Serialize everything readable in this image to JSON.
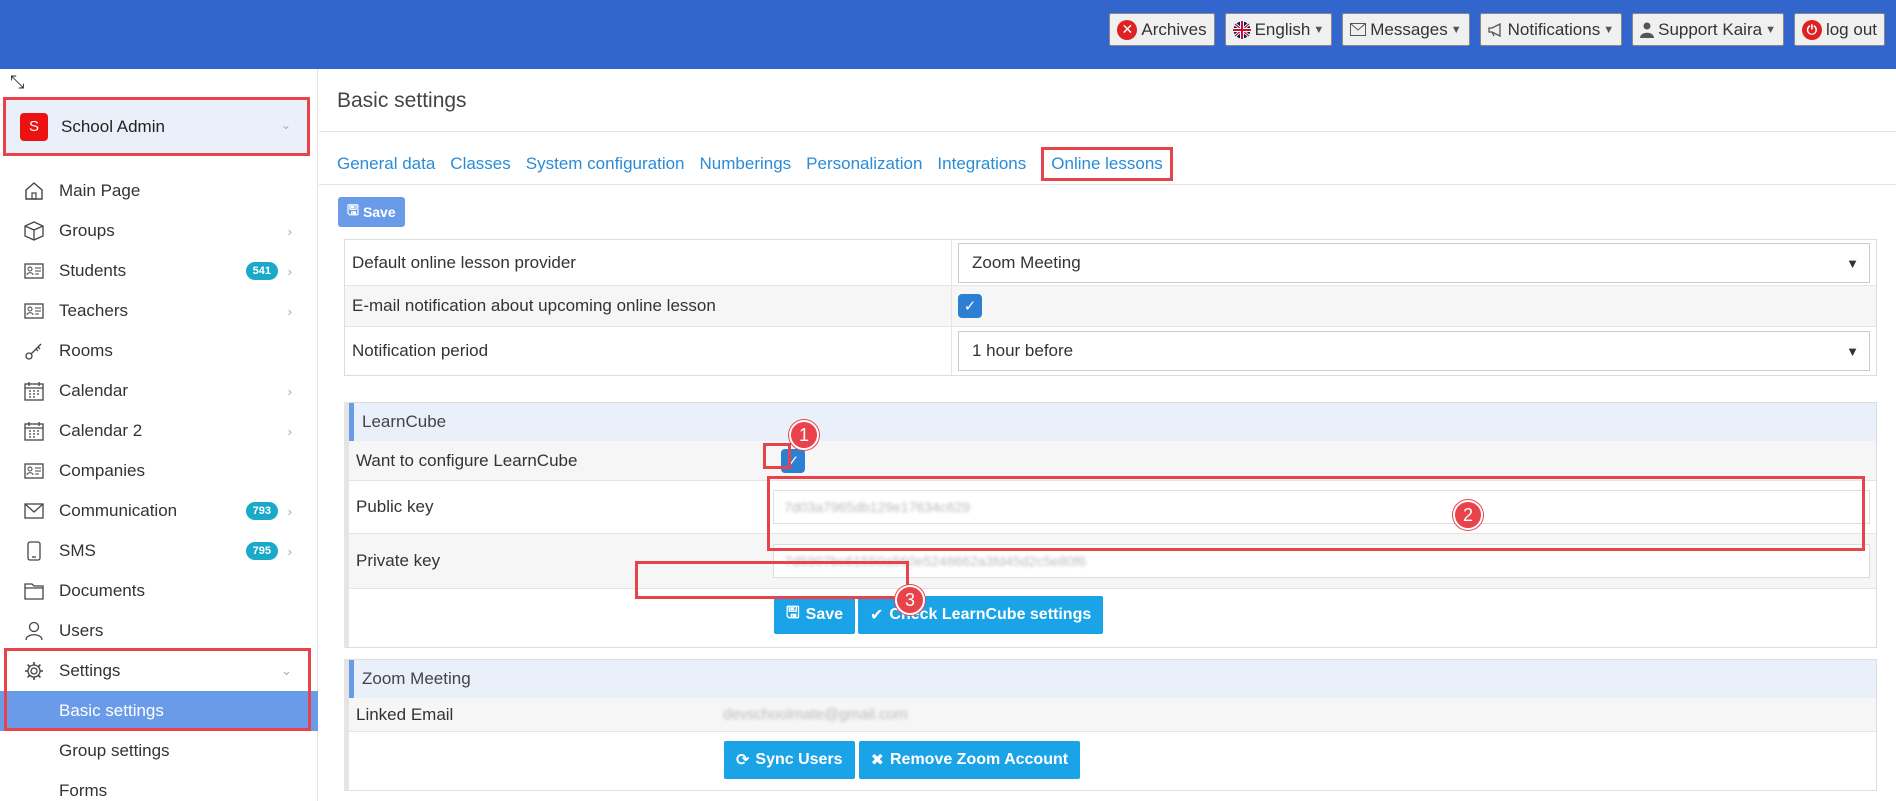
{
  "topbar": {
    "buttons": [
      {
        "label": "Archives",
        "icon": "close-circle-icon"
      },
      {
        "label": "English",
        "icon": "uk-flag-icon"
      },
      {
        "label": "Messages",
        "icon": "envelope-icon"
      },
      {
        "label": "Notifications",
        "icon": "megaphone-icon"
      },
      {
        "label": "Support Kaira",
        "icon": "user-icon"
      },
      {
        "label": "log out",
        "icon": "power-icon"
      }
    ]
  },
  "sidebar": {
    "account": {
      "avatar_letter": "S",
      "label": "School Admin"
    },
    "items": [
      {
        "label": "Main Page",
        "icon": "home-icon"
      },
      {
        "label": "Groups",
        "icon": "box-icon"
      },
      {
        "label": "Students",
        "icon": "id-card-icon",
        "badge": "541"
      },
      {
        "label": "Teachers",
        "icon": "id-card-icon"
      },
      {
        "label": "Rooms",
        "icon": "key-icon"
      },
      {
        "label": "Calendar",
        "icon": "calendar-icon"
      },
      {
        "label": "Calendar 2",
        "icon": "calendar-icon"
      },
      {
        "label": "Companies",
        "icon": "id-card-icon"
      },
      {
        "label": "Communication",
        "icon": "envelope-icon",
        "badge": "793"
      },
      {
        "label": "SMS",
        "icon": "mobile-icon",
        "badge": "795"
      },
      {
        "label": "Documents",
        "icon": "folder-icon"
      },
      {
        "label": "Users",
        "icon": "user-icon"
      },
      {
        "label": "Settings",
        "icon": "gear-icon"
      }
    ],
    "subitems": [
      {
        "label": "Basic settings",
        "active": true
      },
      {
        "label": "Group settings"
      },
      {
        "label": "Forms"
      }
    ]
  },
  "main": {
    "title": "Basic settings",
    "tabs": [
      "General data",
      "Classes",
      "System configuration",
      "Numberings",
      "Personalization",
      "Integrations",
      "Online lessons"
    ],
    "save_label": "Save",
    "general": {
      "provider_label": "Default online lesson provider",
      "provider_value": "Zoom Meeting",
      "email_notif_label": "E-mail notification about upcoming online lesson",
      "period_label": "Notification period",
      "period_value": "1 hour before"
    },
    "learncube": {
      "title": "LearnCube",
      "configure_label": "Want to configure LearnCube",
      "public_key_label": "Public key",
      "public_key_value": "7d03a7965db129e17634c629",
      "private_key_label": "Private key",
      "private_key_value": "7d5907bc61550a560e5248662a3fd45d2c5e80f6",
      "save_label": "Save",
      "check_label": "Check LearnCube settings"
    },
    "zoom": {
      "title": "Zoom Meeting",
      "email_label": "Linked Email",
      "email_value": "devschoolmate@gmail.com",
      "sync_label": "Sync Users",
      "remove_label": "Remove Zoom Account"
    },
    "annotations": [
      "1",
      "2",
      "3"
    ]
  },
  "colors": {
    "topbar": "#3366cc",
    "accent": "#1aa3e6",
    "highlight": "#e8424b",
    "badge": "#1aa9c9"
  }
}
